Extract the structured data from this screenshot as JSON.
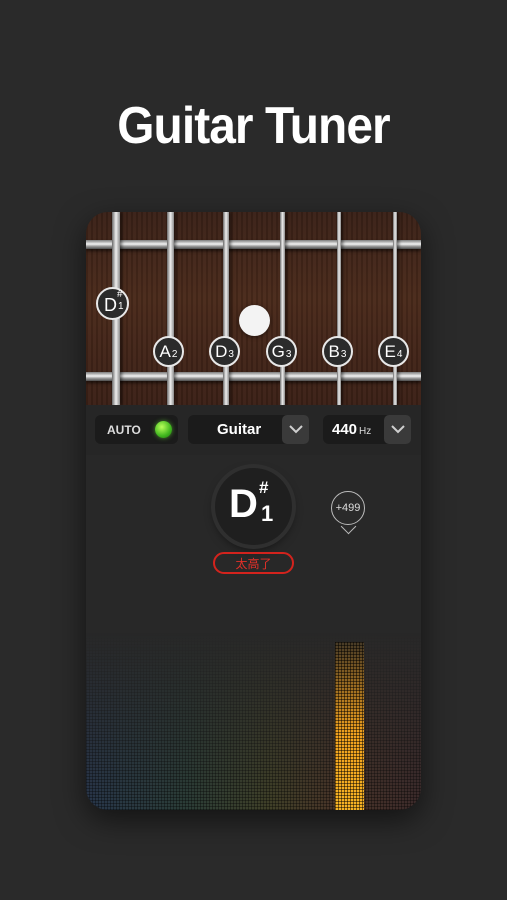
{
  "headline": "Guitar Tuner",
  "fretboard": {
    "current_note": {
      "name": "D",
      "sharp": "#",
      "octave": "1"
    },
    "strings": [
      {
        "name": "A",
        "octave": "2"
      },
      {
        "name": "D",
        "octave": "3"
      },
      {
        "name": "G",
        "octave": "3"
      },
      {
        "name": "B",
        "octave": "3"
      },
      {
        "name": "E",
        "octave": "4"
      }
    ]
  },
  "controls": {
    "auto_label": "AUTO",
    "instrument": "Guitar",
    "reference_value": "440",
    "reference_unit": "Hz"
  },
  "tuner": {
    "note": "D",
    "sharp": "#",
    "octave": "1",
    "cents": "+499",
    "status": "太高了"
  },
  "colors": {
    "accent_green": "#3fb51e",
    "status_red": "#d3231d",
    "peak_orange": "#f2a21f"
  },
  "icons": [
    "chevron-down-icon",
    "led-indicator-icon"
  ]
}
